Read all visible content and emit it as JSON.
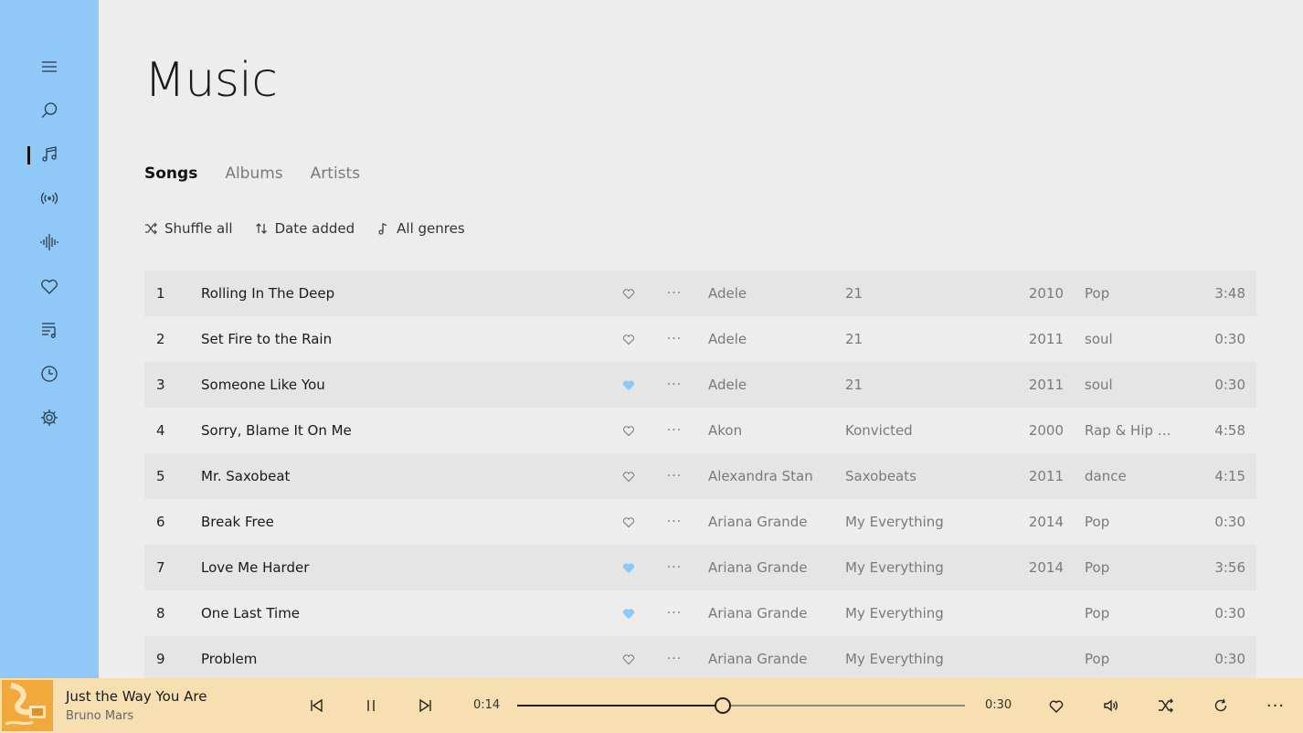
{
  "sidebar": {
    "items": [
      {
        "name": "menu-icon"
      },
      {
        "name": "search-icon"
      },
      {
        "name": "music-note-icon"
      },
      {
        "name": "radio-icon"
      },
      {
        "name": "waveform-icon"
      },
      {
        "name": "heart-icon"
      },
      {
        "name": "playlist-icon"
      },
      {
        "name": "clock-icon"
      },
      {
        "name": "settings-icon"
      }
    ],
    "active_index": 2
  },
  "page_title": "Music",
  "tabs": [
    {
      "label": "Songs",
      "active": true
    },
    {
      "label": "Albums",
      "active": false
    },
    {
      "label": "Artists",
      "active": false
    }
  ],
  "toolbar": {
    "shuffle_label": "Shuffle all",
    "sort_label": "Date added",
    "genre_label": "All genres"
  },
  "songs": [
    {
      "num": "1",
      "title": "Rolling In The Deep",
      "liked": false,
      "artist": "Adele",
      "album": "21",
      "year": "2010",
      "genre": "Pop",
      "duration": "3:48"
    },
    {
      "num": "2",
      "title": "Set Fire to the Rain",
      "liked": false,
      "artist": "Adele",
      "album": "21",
      "year": "2011",
      "genre": "soul",
      "duration": "0:30"
    },
    {
      "num": "3",
      "title": "Someone Like You",
      "liked": true,
      "artist": "Adele",
      "album": "21",
      "year": "2011",
      "genre": "soul",
      "duration": "0:30"
    },
    {
      "num": "4",
      "title": "Sorry, Blame It On Me",
      "liked": false,
      "artist": "Akon",
      "album": "Konvicted",
      "year": "2000",
      "genre": "Rap & Hip H...",
      "duration": "4:58"
    },
    {
      "num": "5",
      "title": "Mr. Saxobeat",
      "liked": false,
      "artist": "Alexandra Stan",
      "album": "Saxobeats",
      "year": "2011",
      "genre": "dance",
      "duration": "4:15"
    },
    {
      "num": "6",
      "title": "Break Free",
      "liked": false,
      "artist": "Ariana Grande",
      "album": "My Everything",
      "year": "2014",
      "genre": "Pop",
      "duration": "0:30"
    },
    {
      "num": "7",
      "title": "Love Me Harder",
      "liked": true,
      "artist": "Ariana Grande",
      "album": "My Everything",
      "year": "2014",
      "genre": "Pop",
      "duration": "3:56"
    },
    {
      "num": "8",
      "title": "One Last Time",
      "liked": true,
      "artist": "Ariana Grande",
      "album": "My Everything",
      "year": "",
      "genre": "Pop",
      "duration": "0:30"
    },
    {
      "num": "9",
      "title": "Problem",
      "liked": false,
      "artist": "Ariana Grande",
      "album": "My Everything",
      "year": "",
      "genre": "Pop",
      "duration": "0:30"
    }
  ],
  "player": {
    "title": "Just the Way You Are",
    "artist": "Bruno Mars",
    "elapsed": "0:14",
    "total": "0:30",
    "progress": 0.46
  },
  "colors": {
    "sidebar": "#90c8f7",
    "player": "#f7dfb2",
    "liked": "#8ec8f6",
    "background": "#ededed"
  }
}
